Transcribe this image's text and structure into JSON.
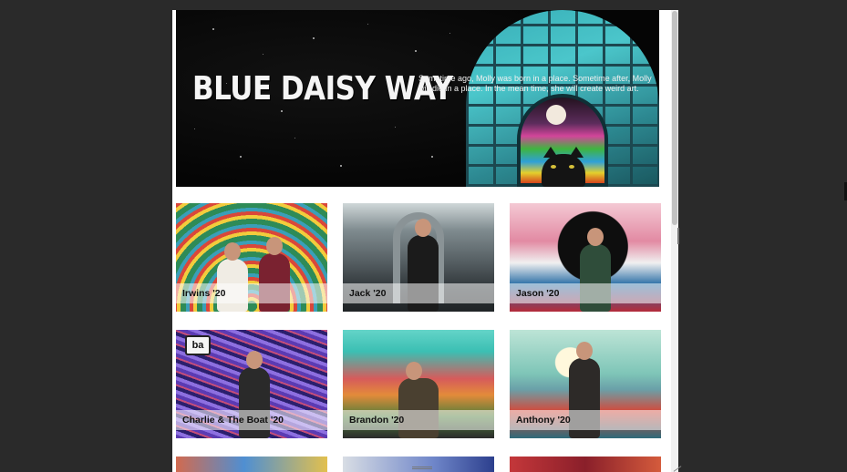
{
  "hero": {
    "title": "BLUE DAISY WAY",
    "blurb": "Sometime ago, Molly was born in a place. Sometime after, Molly will die in a place. In the mean time, she will create weird art."
  },
  "gallery": {
    "items": [
      {
        "caption": "Irwins '20"
      },
      {
        "caption": "Jack '20"
      },
      {
        "caption": "Jason '20"
      },
      {
        "caption": "Charlie & The Boat '20",
        "sign": "ba"
      },
      {
        "caption": "Brandon '20"
      },
      {
        "caption": "Anthony '20"
      }
    ]
  },
  "colors": {
    "page_bg": "#2a2a2a",
    "arch_teal": "#4fd1d6",
    "caption_bar": "rgba(255,255,255,0.55)"
  }
}
